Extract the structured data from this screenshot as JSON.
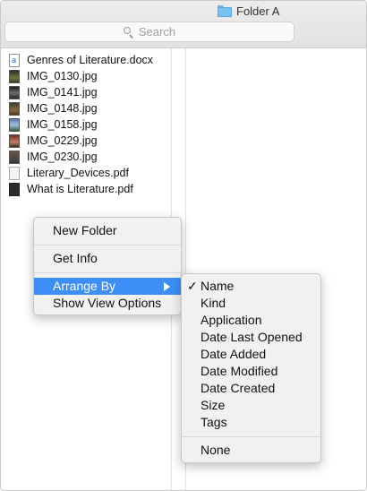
{
  "window": {
    "title": "Folder A",
    "folder_color": "#7cc0f0"
  },
  "search": {
    "placeholder": "Search"
  },
  "files": [
    {
      "name": "Genres of Literature.docx",
      "icon": "word-doc-icon"
    },
    {
      "name": "IMG_0130.jpg",
      "icon": "image-thumbnail-icon"
    },
    {
      "name": "IMG_0141.jpg",
      "icon": "image-thumbnail-icon"
    },
    {
      "name": "IMG_0148.jpg",
      "icon": "image-thumbnail-icon"
    },
    {
      "name": "IMG_0158.jpg",
      "icon": "image-thumbnail-icon"
    },
    {
      "name": "IMG_0229.jpg",
      "icon": "image-thumbnail-icon"
    },
    {
      "name": "IMG_0230.jpg",
      "icon": "image-thumbnail-icon"
    },
    {
      "name": "Literary_Devices.pdf",
      "icon": "pdf-icon"
    },
    {
      "name": "What is Literature.pdf",
      "icon": "pdf-icon"
    }
  ],
  "context_menu": {
    "new_folder": "New Folder",
    "get_info": "Get Info",
    "arrange_by": "Arrange By",
    "show_view_options": "Show View Options"
  },
  "arrange_submenu": {
    "checkmark": "✓",
    "items": [
      "Name",
      "Kind",
      "Application",
      "Date Last Opened",
      "Date Added",
      "Date Modified",
      "Date Created",
      "Size",
      "Tags"
    ],
    "none": "None",
    "selected": "Name"
  },
  "colors": {
    "highlight": "#3e8ef7"
  }
}
